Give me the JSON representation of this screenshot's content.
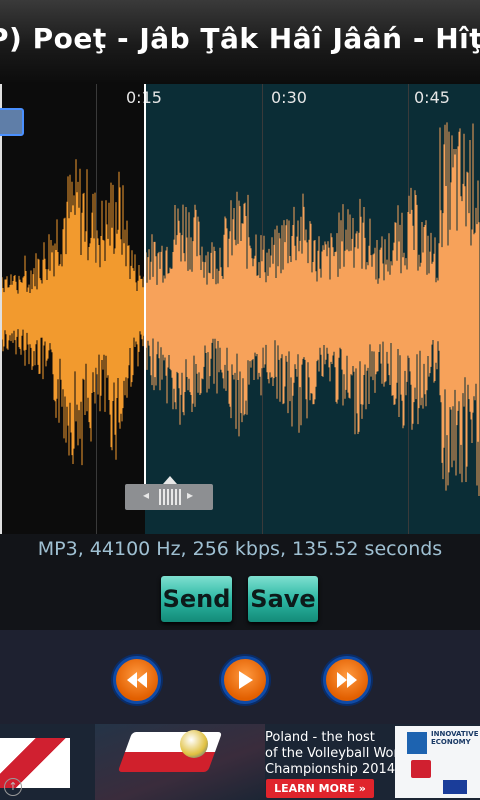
{
  "title": "P) Poeţ - Jâb Ţâk Hâî Jââń - Hîţeşh",
  "timeline": {
    "labels": [
      "0:15",
      "0:30",
      "0:45"
    ]
  },
  "file_info": "MP3, 44100 Hz, 256 kbps, 135.52 seconds",
  "buttons": {
    "send": "Send",
    "save": "Save"
  },
  "controls": {
    "rewind_icon": "rewind-icon",
    "play_icon": "play-icon",
    "fast_forward_icon": "fast-forward-icon"
  },
  "ad": {
    "line1": "Poland - the host",
    "line2": "of the Volleyball World",
    "line3": "Championship 2014",
    "cta": "LEARN MORE »",
    "eu_text": "INNOVATIVE ECONOMY"
  },
  "colors": {
    "waveform": "#f7a25a",
    "waveform_unselected": "#f29a2e",
    "selection_bg": "#0b2d36",
    "button_teal": "#2db8a4",
    "control_orange": "#e25f00"
  }
}
